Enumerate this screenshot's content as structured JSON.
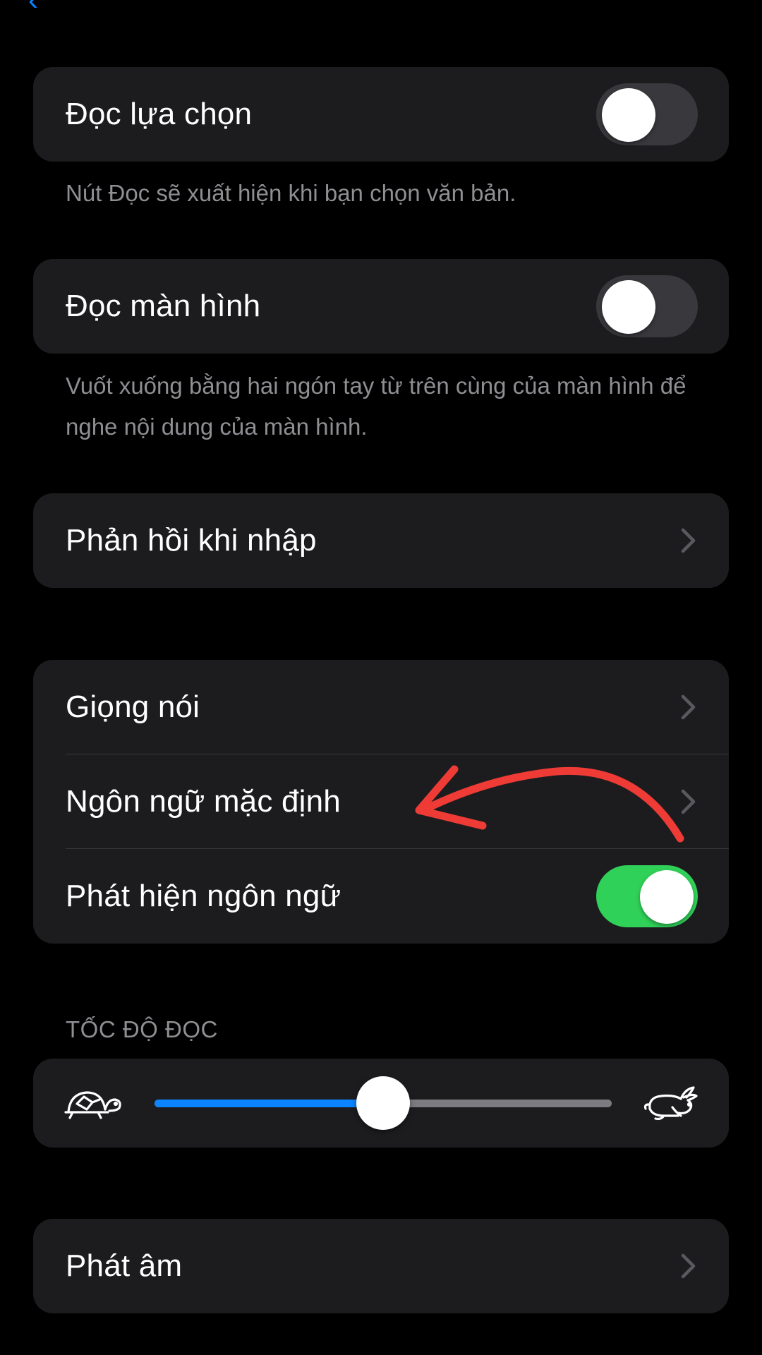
{
  "colors": {
    "background": "#000000",
    "group_background": "#1c1c1e",
    "toggle_on": "#30d158",
    "toggle_off": "#39393d",
    "slider_fill": "#0a84ff",
    "secondary_text": "#8e8e93",
    "annotation_arrow": "#ef3b36"
  },
  "speak_selection": {
    "label": "Đọc lựa chọn",
    "enabled": false,
    "footnote": "Nút Đọc sẽ xuất hiện khi bạn chọn văn bản."
  },
  "speak_screen": {
    "label": "Đọc màn hình",
    "enabled": false,
    "footnote": "Vuốt xuống bằng hai ngón tay từ trên cùng của màn hình để nghe nội dung của màn hình."
  },
  "typing_feedback": {
    "label": "Phản hồi khi nhập"
  },
  "voice_group": {
    "voices_label": "Giọng nói",
    "default_language_label": "Ngôn ngữ mặc định",
    "detect_language_label": "Phát hiện ngôn ngữ",
    "detect_language_enabled": true
  },
  "speaking_rate": {
    "header": "TỐC ĐỘ ĐỌC",
    "value_fraction": 0.5,
    "slow_icon": "tortoise-icon",
    "fast_icon": "hare-icon"
  },
  "pronunciations": {
    "label": "Phát âm"
  }
}
